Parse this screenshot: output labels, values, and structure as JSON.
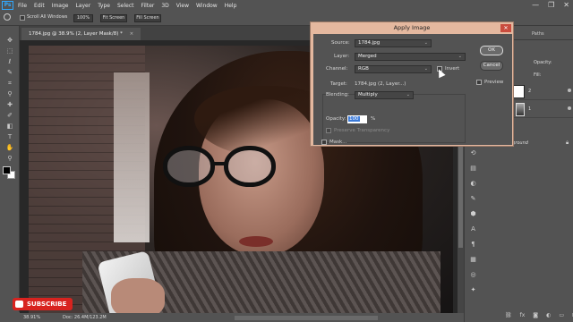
{
  "menubar": {
    "logo": "Ps",
    "items": [
      "File",
      "Edit",
      "Image",
      "Layer",
      "Type",
      "Select",
      "Filter",
      "3D",
      "View",
      "Window",
      "Help"
    ],
    "window_controls": [
      "—",
      "❐",
      "✕"
    ]
  },
  "options_bar": {
    "scroll_all_windows": "Scroll All Windows",
    "zoom_100": "100%",
    "fit_screen": "Fit Screen",
    "fill_screen": "Fill Screen"
  },
  "document": {
    "tab_title": "1784.jpg @ 38.9% (2, Layer Mask/8) *",
    "tab_close": "×"
  },
  "status_bar": {
    "zoom": "38.91%",
    "doc_size": "Doc: 26.4M/123.2M"
  },
  "layers_panel": {
    "tabs": [
      "nels",
      "Paths"
    ],
    "opacity_label": "Opacity:",
    "fill_label": "Fill:",
    "layers": [
      {
        "name": "2"
      },
      {
        "name": "1"
      }
    ],
    "background_layer": "Background"
  },
  "dialog": {
    "title": "Apply Image",
    "close": "✕",
    "source_label": "Source:",
    "source_value": "1784.jpg",
    "layer_label": "Layer:",
    "layer_value": "Merged",
    "channel_label": "Channel:",
    "channel_value": "RGB",
    "invert_label": "Invert",
    "target_label": "Target:",
    "target_value": "1784.jpg (2, Layer...)",
    "blending_label": "Blending:",
    "blending_value": "Multiply",
    "opacity_label": "Opacity:",
    "opacity_value": "100",
    "opacity_unit": "%",
    "preserve_transparency_label": "Preserve Transparency",
    "mask_label": "Mask...",
    "ok_label": "OK",
    "cancel_label": "Cancel",
    "preview_label": "Preview"
  },
  "overlay": {
    "subscribe_label": "SUBSCRIBE"
  },
  "colors": {
    "accent_selection": "#3b7ad8",
    "dialog_title_bg": "#e4b89f",
    "subscribe_red": "#d8231f",
    "ps_blue": "#31a8ff"
  }
}
